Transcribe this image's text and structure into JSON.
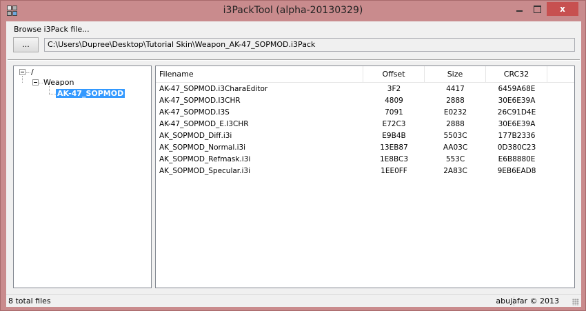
{
  "window": {
    "title": "i3PackTool (alpha-20130329)",
    "close_label": "x"
  },
  "browse": {
    "label": "Browse i3Pack file...",
    "button_label": "...",
    "path_value": "C:\\Users\\Dupree\\Desktop\\Tutorial Skin\\Weapon_AK-47_SOPMOD.i3Pack"
  },
  "tree": {
    "root": "/",
    "folder": "Weapon",
    "selected": "AK-47_SOPMOD"
  },
  "table": {
    "columns": [
      "Filename",
      "Offset",
      "Size",
      "CRC32"
    ],
    "rows": [
      [
        "AK-47_SOPMOD.i3CharaEditor",
        "3F2",
        "4417",
        "6459A68E"
      ],
      [
        "AK-47_SOPMOD.I3CHR",
        "4809",
        "2888",
        "30E6E39A"
      ],
      [
        "AK-47_SOPMOD.I3S",
        "7091",
        "E0232",
        "26C91D4E"
      ],
      [
        "AK-47_SOPMOD_E.I3CHR",
        "E72C3",
        "2888",
        "30E6E39A"
      ],
      [
        "AK_SOPMOD_Diff.i3i",
        "E9B4B",
        "5503C",
        "177B2336"
      ],
      [
        "AK_SOPMOD_Normal.i3i",
        "13EB87",
        "AA03C",
        "0D380C23"
      ],
      [
        "AK_SOPMOD_Refmask.i3i",
        "1E8BC3",
        "553C",
        "E6B8880E"
      ],
      [
        "AK_SOPMOD_Specular.i3i",
        "1EE0FF",
        "2A83C",
        "9EB6EAD8"
      ]
    ]
  },
  "status": {
    "left": "8 total files",
    "right": "abujafar © 2013"
  },
  "colors": {
    "frame": "#c98b8d",
    "close": "#c75050",
    "selection": "#3399ff"
  }
}
